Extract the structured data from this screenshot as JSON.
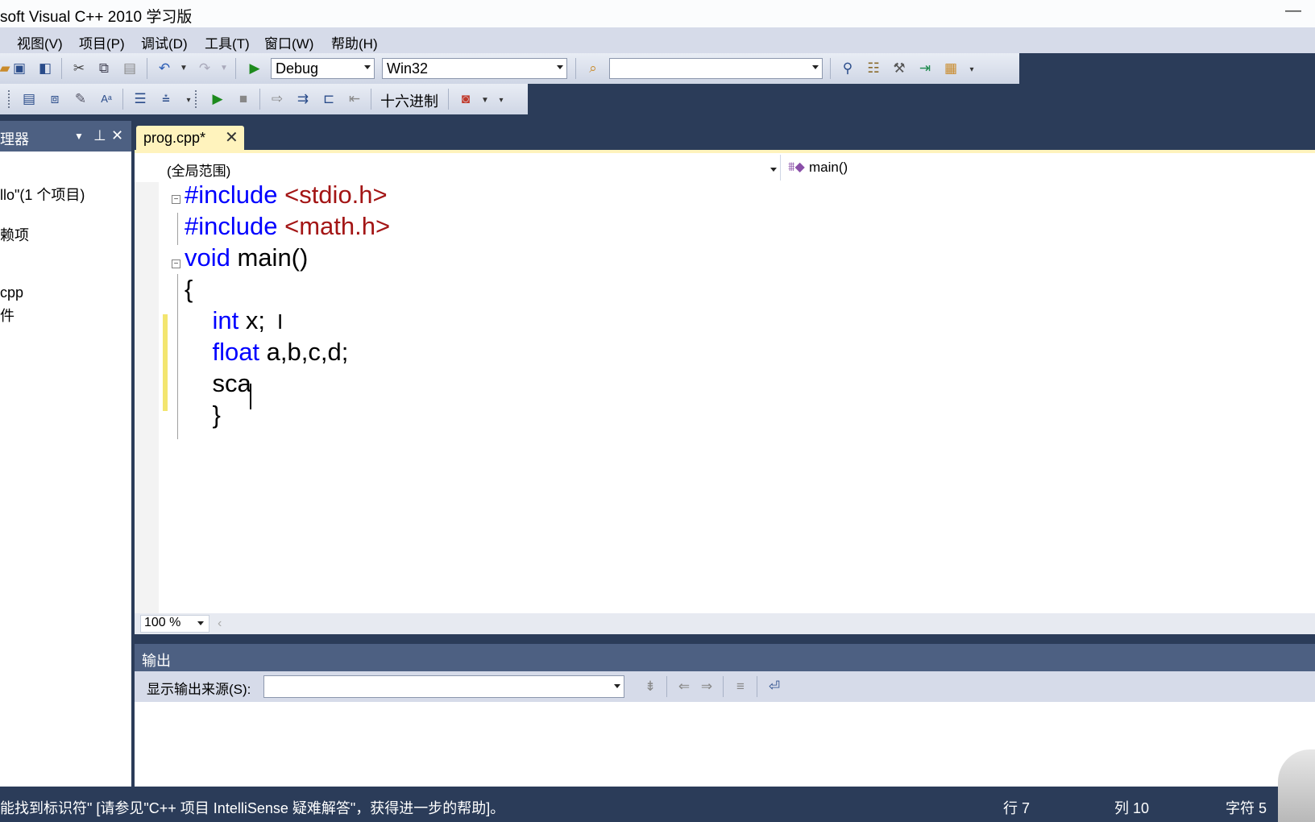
{
  "window": {
    "title": "soft Visual C++ 2010 学习版",
    "minimize": "—"
  },
  "menu": [
    "视图(V)",
    "项目(P)",
    "调试(D)",
    "工具(T)",
    "窗口(W)",
    "帮助(H)"
  ],
  "toolbar1": {
    "config_value": "Debug",
    "platform_value": "Win32",
    "find_value": "",
    "icons": [
      "open-file-icon",
      "save-icon",
      "save-all-icon",
      "cut-icon",
      "copy-icon",
      "paste-icon",
      "undo-icon",
      "redo-icon",
      "start-debug-icon",
      "find-in-files-icon",
      "solution-explorer-icon",
      "properties-icon",
      "toolbox-icon",
      "output-icon",
      "class-view-icon"
    ]
  },
  "toolbar2": {
    "hex_label": "十六进制",
    "icons": [
      "breakpoint-window-icon",
      "locals-icon",
      "callstack-icon",
      "font-size-icon",
      "indent-icon",
      "comment-icon",
      "continue-icon",
      "stop-icon",
      "step-icon",
      "step-into-icon",
      "step-over-icon",
      "step-out-icon",
      "window-icon"
    ]
  },
  "solution_explorer": {
    "title": "理器",
    "pin": "⊥",
    "close": "✕",
    "items": [
      "llo\"(1 个项目)",
      "赖项",
      "cpp",
      "件"
    ]
  },
  "editor": {
    "tab_label": "prog.cpp*",
    "scope": "(全局范围)",
    "function": "main()",
    "lines": [
      {
        "parts": [
          {
            "t": "#include ",
            "c": "kw"
          },
          {
            "t": "<stdio.h>",
            "c": "str"
          }
        ]
      },
      {
        "parts": [
          {
            "t": "#include ",
            "c": "kw"
          },
          {
            "t": "<math.h>",
            "c": "str"
          }
        ]
      },
      {
        "parts": [
          {
            "t": "void",
            "c": "kw"
          },
          {
            "t": " main()",
            "c": ""
          }
        ]
      },
      {
        "parts": [
          {
            "t": "{",
            "c": ""
          }
        ]
      },
      {
        "parts": [
          {
            "t": "    ",
            "c": ""
          },
          {
            "t": "int",
            "c": "kw"
          },
          {
            "t": " x;",
            "c": ""
          }
        ]
      },
      {
        "parts": [
          {
            "t": "    ",
            "c": ""
          },
          {
            "t": "float",
            "c": "kw"
          },
          {
            "t": " a,b,c,d;",
            "c": ""
          }
        ]
      },
      {
        "parts": [
          {
            "t": "    sca",
            "c": ""
          }
        ]
      },
      {
        "parts": [
          {
            "t": "    }",
            "c": ""
          }
        ]
      }
    ],
    "zoom": "100 %"
  },
  "output": {
    "title": "输出",
    "source_label": "显示输出来源(S):",
    "source_value": ""
  },
  "status": {
    "message": "能找到标识符\" [请参见\"C++ 项目 IntelliSense 疑难解答\"，获得进一步的帮助]。",
    "line": "行 7",
    "column": "列 10",
    "char": "字符 5"
  }
}
